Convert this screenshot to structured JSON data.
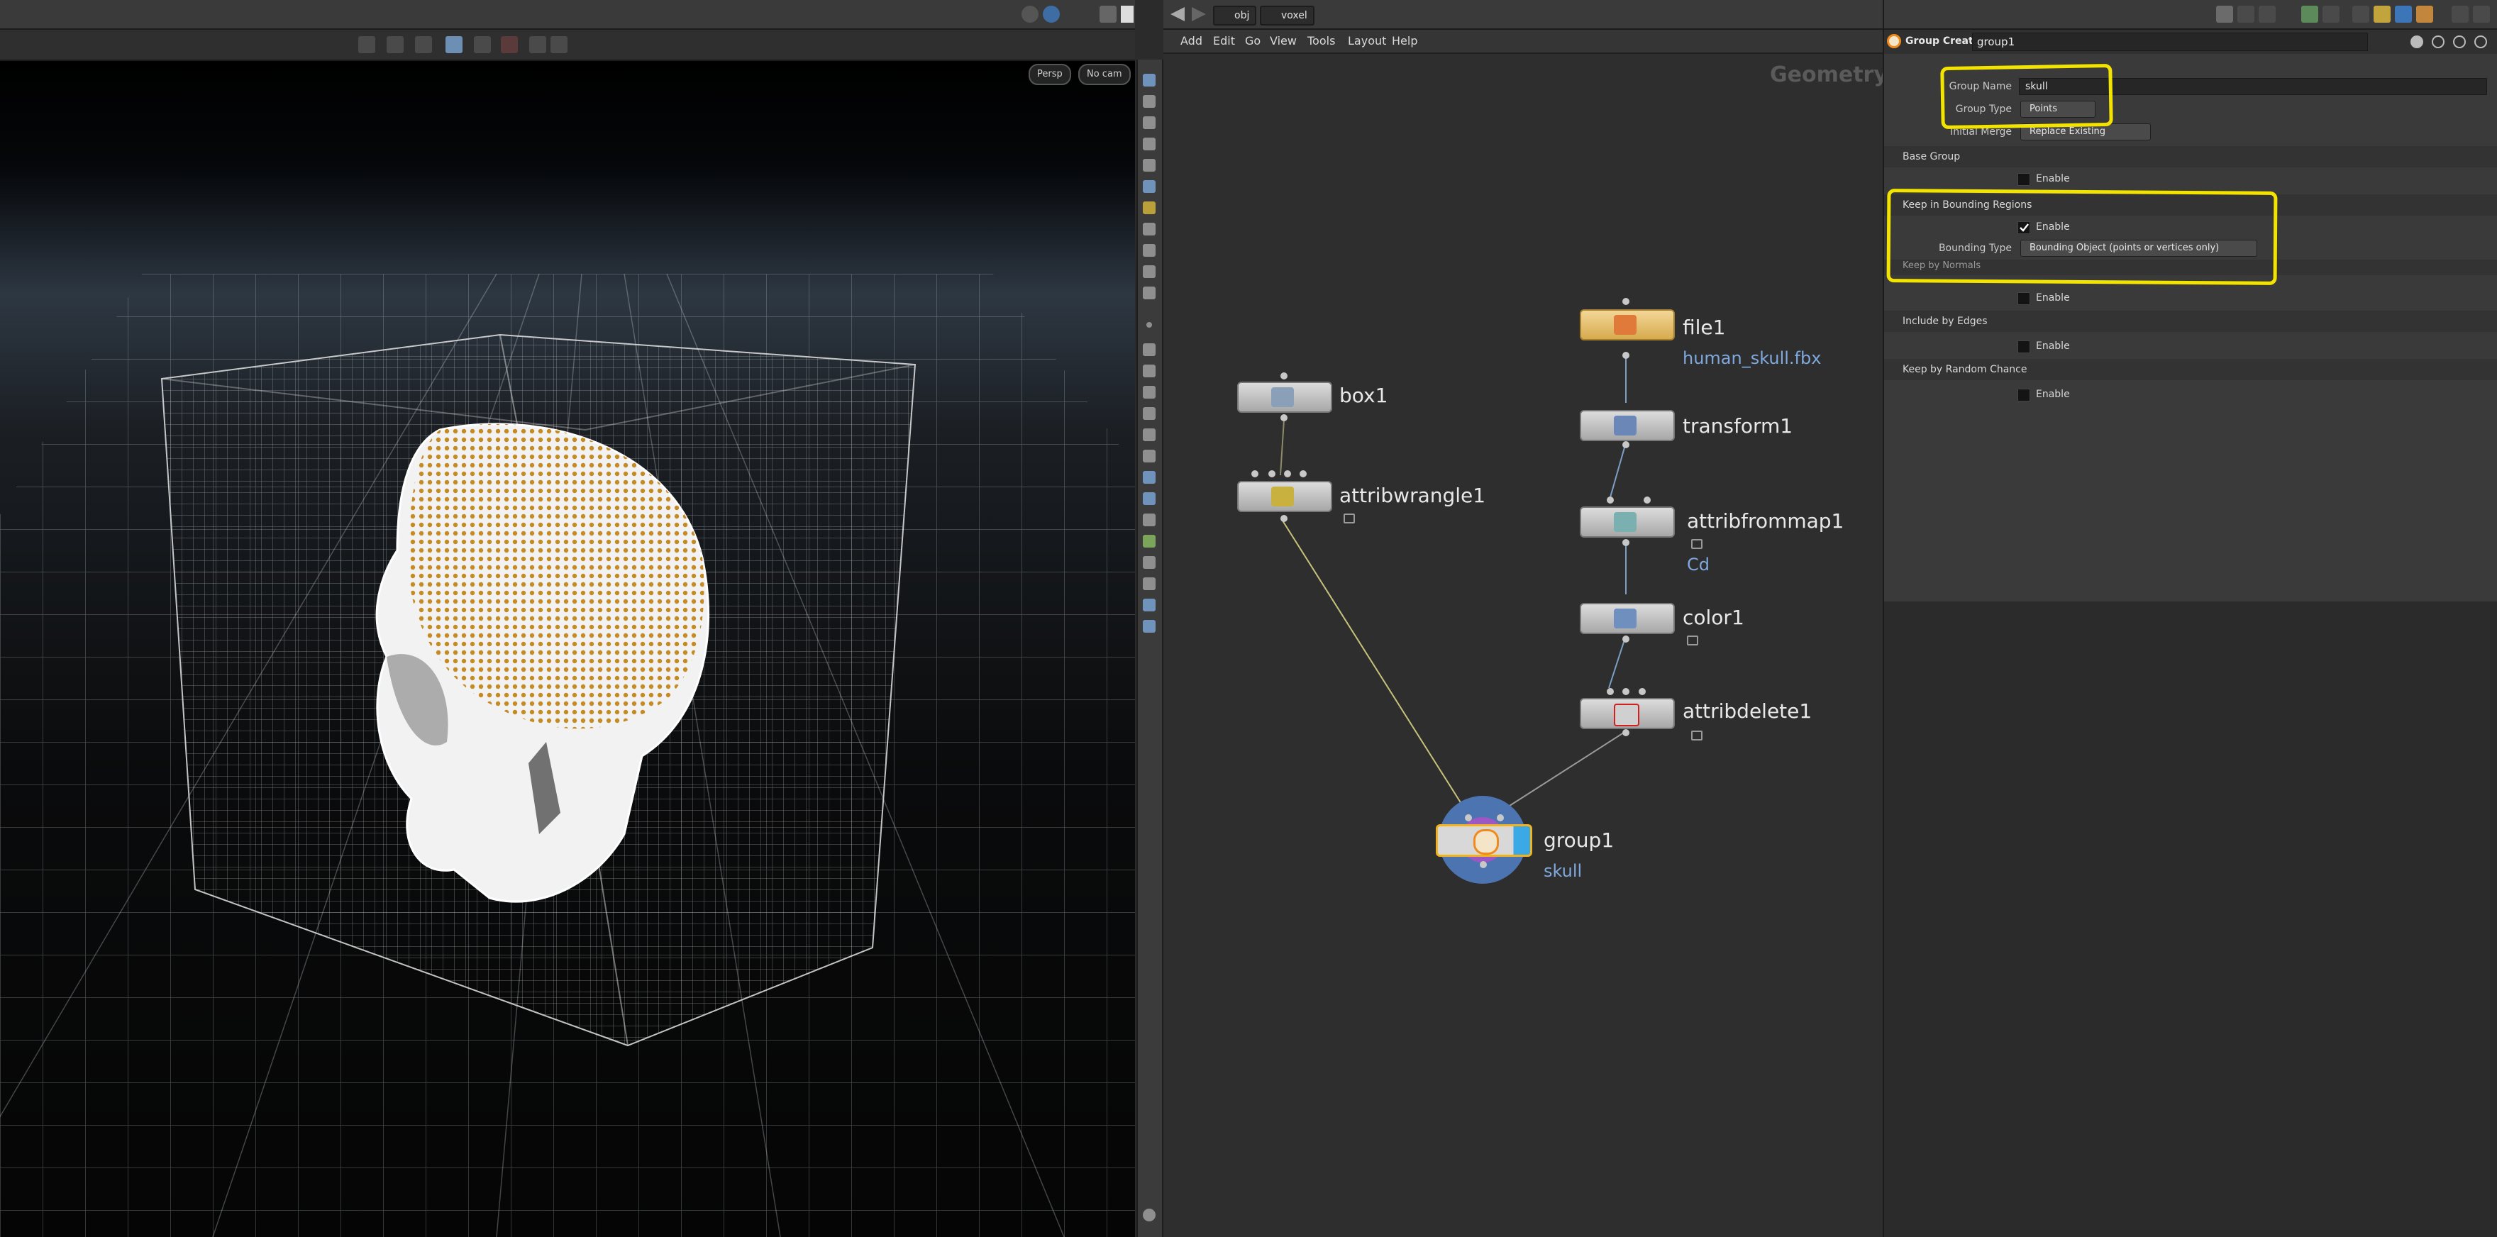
{
  "viewport": {
    "view_mode": "Persp",
    "camera": "No cam",
    "accent": "#d9a030"
  },
  "network": {
    "path": [
      "obj",
      "voxel"
    ],
    "context_label": "Geometry",
    "menu": [
      "Add",
      "Edit",
      "Go",
      "View",
      "Tools",
      "Layout",
      "Help"
    ],
    "nodes": {
      "box1": {
        "name": "box1"
      },
      "attribwrangle1": {
        "name": "attribwrangle1"
      },
      "file1": {
        "name": "file1",
        "sub": "human_skull.fbx"
      },
      "transform1": {
        "name": "transform1"
      },
      "attribfrommap1": {
        "name": "attribfrommap1",
        "sub": "Cd"
      },
      "color1": {
        "name": "color1"
      },
      "attribdelete1": {
        "name": "attribdelete1"
      },
      "group1": {
        "name": "group1",
        "sub": "skull"
      }
    }
  },
  "params": {
    "node_type": "Group Create",
    "node_name": "group1",
    "group_name_label": "Group Name",
    "group_name_value": "skull",
    "group_type_label": "Group Type",
    "group_type_value": "Points",
    "initial_merge_label": "Initial Merge",
    "initial_merge_value": "Replace Existing",
    "sections": {
      "base_group": {
        "title": "Base Group",
        "enable_label": "Enable",
        "checked": false
      },
      "bounding": {
        "title": "Keep in Bounding Regions",
        "enable_label": "Enable",
        "checked": true,
        "type_label": "Bounding Type",
        "type_value": "Bounding Object (points or vertices only)"
      },
      "normals": {
        "title": "Keep by Normals",
        "enable_label": "Enable",
        "checked": false
      },
      "edges": {
        "title": "Include by Edges",
        "enable_label": "Enable",
        "checked": false
      },
      "random": {
        "title": "Keep by Random Chance",
        "enable_label": "Enable",
        "checked": false
      }
    },
    "highlight_color": "#f2e300"
  }
}
